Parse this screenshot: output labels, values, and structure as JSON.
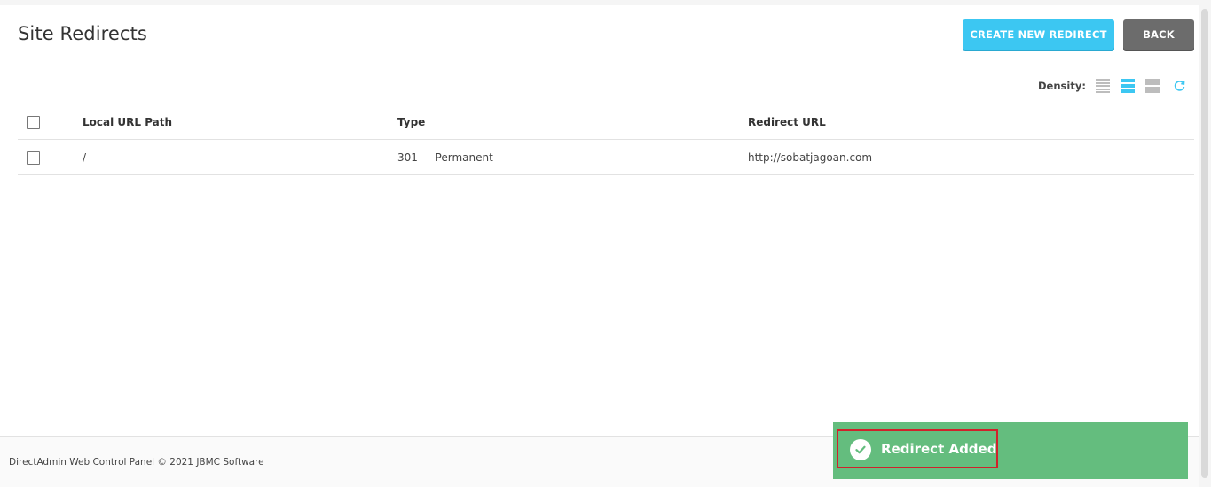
{
  "page": {
    "title": "Site Redirects"
  },
  "toolbar": {
    "create_label": "CREATE NEW REDIRECT",
    "back_label": "BACK",
    "density_label": "Density:"
  },
  "table": {
    "columns": [
      "Local URL Path",
      "Type",
      "Redirect URL"
    ],
    "rows": [
      {
        "path": "/",
        "type": "301 — Permanent",
        "url": "http://sobatjagoan.com"
      }
    ]
  },
  "footer": {
    "text": "DirectAdmin Web Control Panel © 2021 JBMC Software"
  },
  "toast": {
    "message": "Redirect Added"
  },
  "colors": {
    "accent": "#3cc7f2",
    "back_button": "#6c6c6c",
    "toast_success": "#64bd7e",
    "highlight_border": "#d0222b"
  },
  "icons": {
    "density": [
      "density-compact-icon",
      "density-normal-icon",
      "density-comfortable-icon"
    ],
    "refresh": "refresh-icon",
    "toast": "check-circle-icon"
  }
}
